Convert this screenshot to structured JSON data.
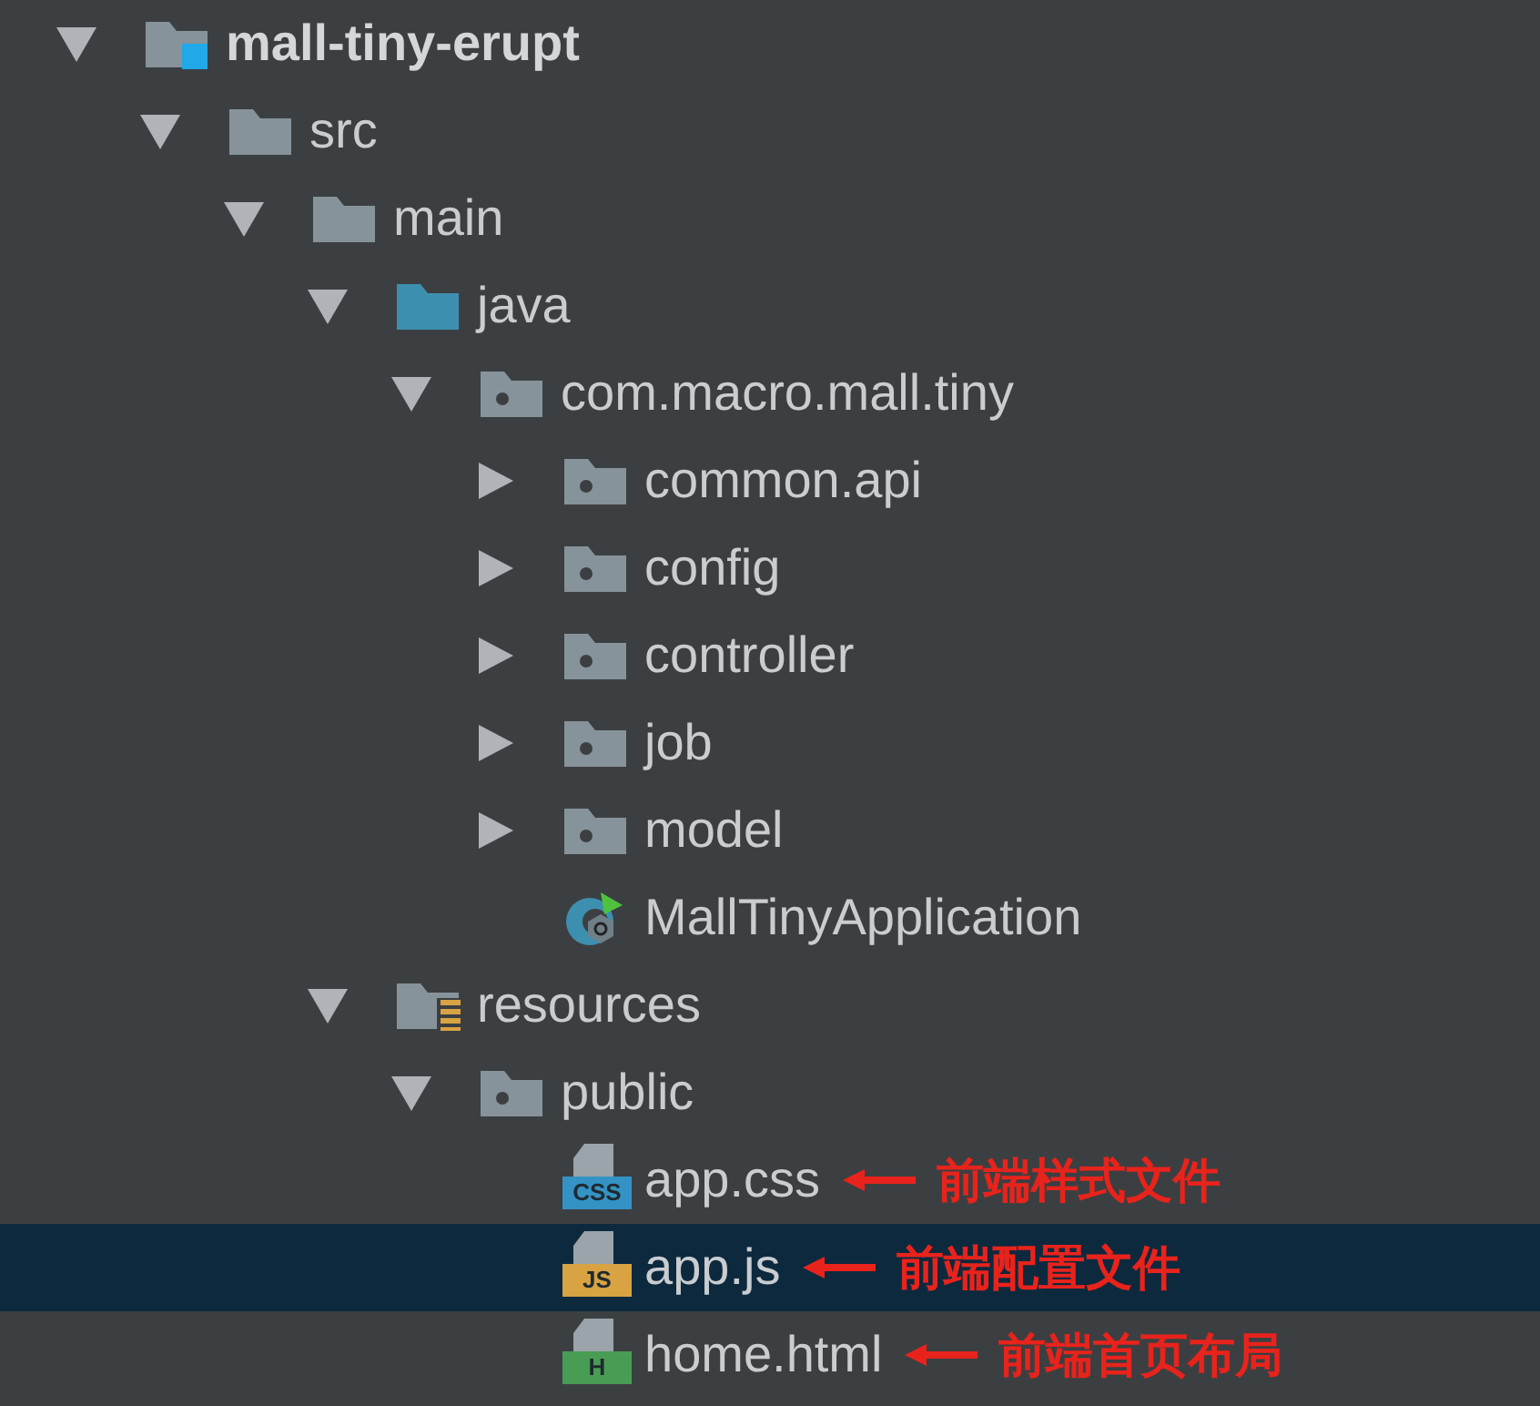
{
  "tree": [
    {
      "label": "mall-tiny-erupt",
      "kind": "module",
      "expanded": true,
      "selected": false,
      "children": [
        {
          "label": "src",
          "kind": "folder",
          "expanded": true,
          "selected": false,
          "children": [
            {
              "label": "main",
              "kind": "folder",
              "expanded": true,
              "selected": false,
              "children": [
                {
                  "label": "java",
                  "kind": "source",
                  "expanded": true,
                  "selected": false,
                  "children": [
                    {
                      "label": "com.macro.mall.tiny",
                      "kind": "package",
                      "expanded": true,
                      "selected": false,
                      "children": [
                        {
                          "label": "common.api",
                          "kind": "package",
                          "expanded": false,
                          "selected": false
                        },
                        {
                          "label": "config",
                          "kind": "package",
                          "expanded": false,
                          "selected": false
                        },
                        {
                          "label": "controller",
                          "kind": "package",
                          "expanded": false,
                          "selected": false
                        },
                        {
                          "label": "job",
                          "kind": "package",
                          "expanded": false,
                          "selected": false
                        },
                        {
                          "label": "model",
                          "kind": "package",
                          "expanded": false,
                          "selected": false
                        },
                        {
                          "label": "MallTinyApplication",
                          "kind": "class",
                          "selected": false
                        }
                      ]
                    }
                  ]
                },
                {
                  "label": "resources",
                  "kind": "resources",
                  "expanded": true,
                  "selected": false,
                  "children": [
                    {
                      "label": "public",
                      "kind": "package",
                      "expanded": true,
                      "selected": false,
                      "children": [
                        {
                          "label": "app.css",
                          "kind": "file",
                          "badge": "CSS",
                          "color": "#3592c4",
                          "selected": false,
                          "note": "前端样式文件"
                        },
                        {
                          "label": "app.js",
                          "kind": "file",
                          "badge": "JS",
                          "color": "#d9a343",
                          "selected": true,
                          "note": "前端配置文件"
                        },
                        {
                          "label": "home.html",
                          "kind": "file",
                          "badge": "H",
                          "color": "#499c54",
                          "selected": false,
                          "note": "前端首页布局"
                        }
                      ]
                    }
                  ]
                }
              ]
            }
          ]
        }
      ]
    }
  ]
}
